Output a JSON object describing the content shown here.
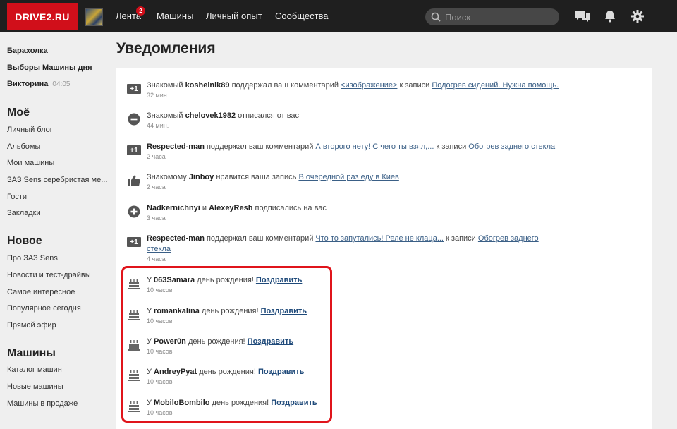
{
  "header": {
    "logo": "DRIVE2.RU",
    "nav": [
      {
        "label": "Лента"
      },
      {
        "label": "Машины"
      },
      {
        "label": "Личный опыт"
      },
      {
        "label": "Сообщества"
      }
    ],
    "feed_badge": "2",
    "search_placeholder": "Поиск",
    "icons": [
      "messages-icon",
      "bell-icon",
      "gear-icon"
    ],
    "accent": "#d10f1a"
  },
  "sidebar": {
    "top_links": [
      {
        "label": "Барахолка"
      },
      {
        "label": "Выборы Машины дня"
      },
      {
        "label": "Викторина",
        "time": "04:05"
      }
    ],
    "sections": [
      {
        "title": "Моё",
        "items": [
          "Личный блог",
          "Альбомы",
          "Мои машины",
          "ЗАЗ Sens серебристая ме...",
          "Гости",
          "Закладки"
        ]
      },
      {
        "title": "Новое",
        "items": [
          "Про ЗАЗ Sens",
          "Новости и тест-драйвы",
          "Самое интересное",
          "Популярное сегодня",
          "Прямой эфир"
        ]
      },
      {
        "title": "Машины",
        "items": [
          "Каталог машин",
          "Новые машины",
          "Машины в продаже"
        ]
      }
    ]
  },
  "page": {
    "title": "Уведомления"
  },
  "notifications": [
    {
      "icon": "plus-one-icon",
      "p1": "Знакомый ",
      "user": "koshelnik89",
      "p2": " поддержал ваш комментарий ",
      "link1": "<изображение>",
      "p3": " к записи ",
      "link2": "Подогрев сидений. Нужна помощь.",
      "time": "32 мин."
    },
    {
      "icon": "minus-circle-icon",
      "p1": "Знакомый ",
      "user": "chelovek1982",
      "p2": " отписался от вас",
      "time": "44 мин."
    },
    {
      "icon": "plus-one-icon",
      "user": "Respected-man",
      "p2": " поддержал ваш комментарий ",
      "link1": "А второго нету! С чего ты взял,...",
      "p3": " к записи ",
      "link2": "Обогрев заднего стекла",
      "time": "2 часа"
    },
    {
      "icon": "thumbs-up-icon",
      "p1": "Знакомому ",
      "user": "Jinboy",
      "p2": " нравится ваша запись ",
      "link1": "В очередной раз еду в Киев",
      "time": "2 часа"
    },
    {
      "icon": "plus-circle-icon",
      "user": "Nadkernichnyi",
      "mid": " и ",
      "user2": "AlexeyResh",
      "p2": " подписались на вас",
      "time": "3 часа"
    },
    {
      "icon": "plus-one-icon",
      "user": "Respected-man",
      "p2": " поддержал ваш комментарий ",
      "link1": "Что то запутались! Реле не клаца...",
      "p3": " к записи ",
      "link2": "Обогрев заднего стекла",
      "time": "4 часа"
    }
  ],
  "birthdays": [
    {
      "prefix": "У ",
      "user": "063Samara",
      "text": " день рождения! ",
      "action": "Поздравить",
      "time": "10 часов"
    },
    {
      "prefix": "У ",
      "user": "romankalina",
      "text": " день рождения! ",
      "action": "Поздравить",
      "time": "10 часов"
    },
    {
      "prefix": "У ",
      "user": "Power0n",
      "text": " день рождения! ",
      "action": "Поздравить",
      "time": "10 часов"
    },
    {
      "prefix": "У ",
      "user": "AndreyPyat",
      "text": " день рождения! ",
      "action": "Поздравить",
      "time": "10 часов"
    },
    {
      "prefix": "У ",
      "user": "MobiloBombilo",
      "text": " день рождения! ",
      "action": "Поздравить",
      "time": "10 часов"
    }
  ],
  "highlight_color": "#e0141b"
}
